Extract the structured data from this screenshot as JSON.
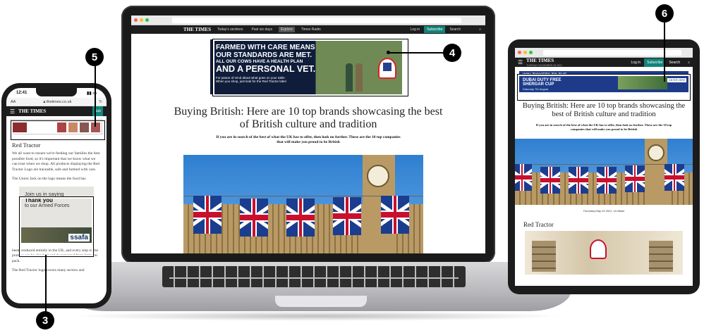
{
  "laptop": {
    "nav": {
      "logo": "THE TIMES",
      "items": [
        "Today's sections",
        "Past six days",
        "Explore",
        "Times Radio"
      ],
      "login": "Log in",
      "subscribe": "Subscribe",
      "search": "Search"
    },
    "ad": {
      "line1": "FARMED WITH CARE MEANS",
      "line2": "OUR STANDARDS ARE MET.",
      "line3": "ALL OUR COWS HAVE A HEALTH PLAN",
      "line4": "AND A PERSONAL VET.",
      "small1": "For peace of mind about what goes on your table",
      "small2": "When you shop, just look for the Red Tractor label"
    },
    "headline": "Buying British: Here are 10 top brands showcasing the best of British culture and tradition",
    "standfirst": "If you are in search of the best of what the UK has to offer, then look no further. These are the 10 top companies that will make you proud to be British"
  },
  "phone": {
    "time": "12:41",
    "url_prefix": "AA",
    "url": "thetimes.co.uk",
    "logo": "THE TIMES",
    "subscribe": "Sub",
    "section_title": "Red Tractor",
    "para1": "We all want to ensure we're feeding our families the best possible food, so it's important that we know what we can trust when we shop. All products displaying the Red Tractor Logo are traceable, safe and farmed with care.",
    "para2": "The Union Jack on the logo means the food has",
    "card_line1": "Join us in saying",
    "card_line2": "Thank you",
    "card_line3": "to our Armed Forces",
    "card_brand": "ssafa",
    "para3": "been produced entirely in the UK, and every step of the journey can be checked and documented from farms to pack.",
    "para4": "The Red Tractor logo covers many sectors and"
  },
  "tablet": {
    "logo": "THE TIMES",
    "date": "TUESDAY NOVEMBER 09 2021",
    "login": "Log in",
    "subscribe": "Subscribe",
    "search": "Search",
    "ad_line1": "WIN TICKETS TO THE",
    "ad_line2": "DUBAI DUTY FREE",
    "ad_line3": "SHERGAR CUP",
    "ad_line4": "Saturday 7th August",
    "ad_enter": "ENTER HERE",
    "headline": "Buying British: Here are 10 top brands showcasing the best of British culture and tradition",
    "standfirst": "If you are in search of the best of what the UK has to offer, then look no further. These are the 10 top companies that will make you proud to be British",
    "article_date": "Thursday May 20 2021, 10.58am",
    "section_title": "Red Tractor"
  },
  "callouts": {
    "c3": "3",
    "c4": "4",
    "c5": "5",
    "c6": "6"
  },
  "colors": {
    "subscribe_green": "#12847a",
    "nav_dark": "#1d1d1d",
    "callout_black": "#000000"
  }
}
